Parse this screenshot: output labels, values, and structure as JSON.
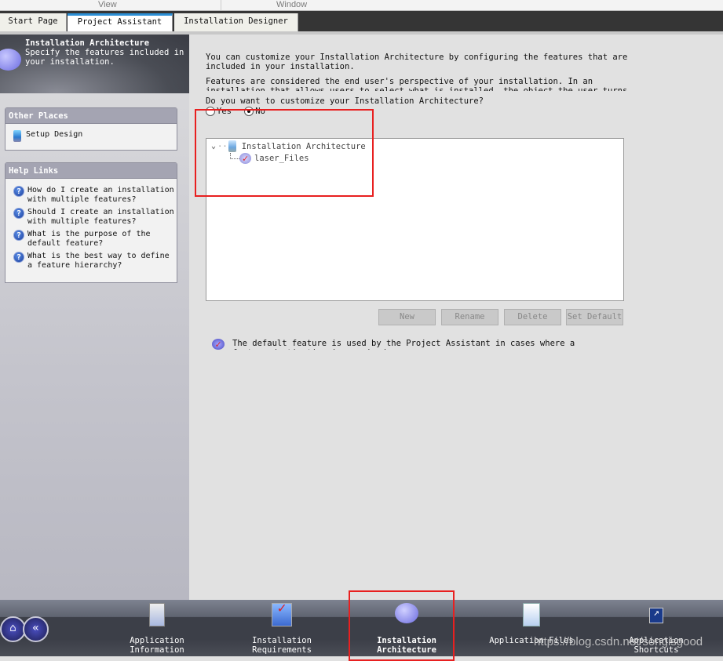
{
  "menu": {
    "items": [
      "View",
      "Window"
    ]
  },
  "tabs": [
    {
      "label": "Start Page"
    },
    {
      "label": "Project Assistant"
    },
    {
      "label": "Installation Designer"
    }
  ],
  "left_header": {
    "title": "Installation Architecture",
    "description": "Specify the features included in your installation."
  },
  "other_places": {
    "title": "Other Places",
    "items": [
      {
        "label": "Setup Design"
      }
    ]
  },
  "help_links": {
    "title": "Help Links",
    "items": [
      {
        "label": "How do I create an installation with multiple features?"
      },
      {
        "label": "Should I create an installation with multiple features?"
      },
      {
        "label": "What is the purpose of the default feature?"
      },
      {
        "label": "What is the best way to define a feature hierarchy?"
      }
    ]
  },
  "main": {
    "intro": "You can customize your Installation Architecture by configuring the features that are included in your installation.",
    "features_text": "Features are considered the end user's perspective of your installation. In an installation that allows users to select what is installed, the object the user turns on and off is a feature.",
    "question": "Do you want to customize your Installation Architecture?",
    "options": [
      {
        "label": "Yes",
        "selected": false
      },
      {
        "label": "No",
        "selected": true
      }
    ],
    "tree": {
      "root": "Installation Architecture",
      "children": [
        "laser_Files"
      ]
    },
    "buttons": {
      "new": "New",
      "rename": "Rename",
      "delete": "Delete",
      "set_default": "Set Default"
    },
    "note": "The default feature is used by the Project Assistant in cases where a feature destination is required."
  },
  "bottom_nav": [
    {
      "label": "Application Information",
      "active": false
    },
    {
      "label": "Installation Requirements",
      "active": false
    },
    {
      "label": "Installation Architecture",
      "active": true
    },
    {
      "label": "Application Files",
      "active": false
    },
    {
      "label": "Application Shortcuts",
      "active": false
    }
  ],
  "watermark": "https://blog.csdn.net/songisgood",
  "colors": {
    "accent_tab": "#2b8fd6",
    "annotation": "#e82020"
  }
}
